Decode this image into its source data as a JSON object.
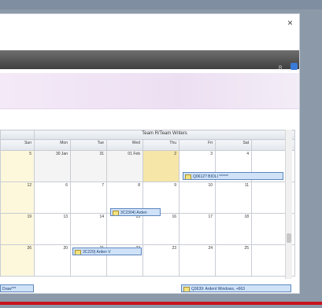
{
  "window": {
    "close_glyph": "×"
  },
  "toolbar": {
    "label": "R"
  },
  "calendar": {
    "group_label": "Team R/Team Writers",
    "left_col_header": "Sun",
    "days": [
      "Mon",
      "Tue",
      "Wed",
      "Thu",
      "Fri",
      "Sat",
      "Sun"
    ],
    "weeks": [
      {
        "left": "5",
        "dates": [
          "30 Jan",
          "31",
          "01 Feb",
          "2",
          "3",
          "4",
          "5"
        ]
      },
      {
        "left": "12",
        "dates": [
          "6",
          "7",
          "8",
          "9",
          "10",
          "11",
          "12"
        ]
      },
      {
        "left": "19",
        "dates": [
          "13",
          "14",
          "15",
          "16",
          "17",
          "18",
          "19"
        ]
      },
      {
        "left": "26",
        "dates": [
          "20",
          "21",
          "22",
          "23",
          "24",
          "25",
          "26"
        ]
      }
    ],
    "events": [
      {
        "label": "Q0612? BIOLI ******",
        "icon": "task-icon"
      },
      {
        "label": "3C2304) Arden",
        "icon": "task-icon"
      },
      {
        "label": "3C229) Arden V",
        "icon": "task-icon"
      },
      {
        "label": "Q3639: Ardent Windows, +663",
        "icon": "task-icon"
      },
      {
        "label": "Draw***",
        "icon": "task-icon"
      }
    ]
  },
  "colors": {
    "accent_line": "#c6141f",
    "event_fill": "#cfe2f8",
    "today": "#f6e6a8"
  }
}
